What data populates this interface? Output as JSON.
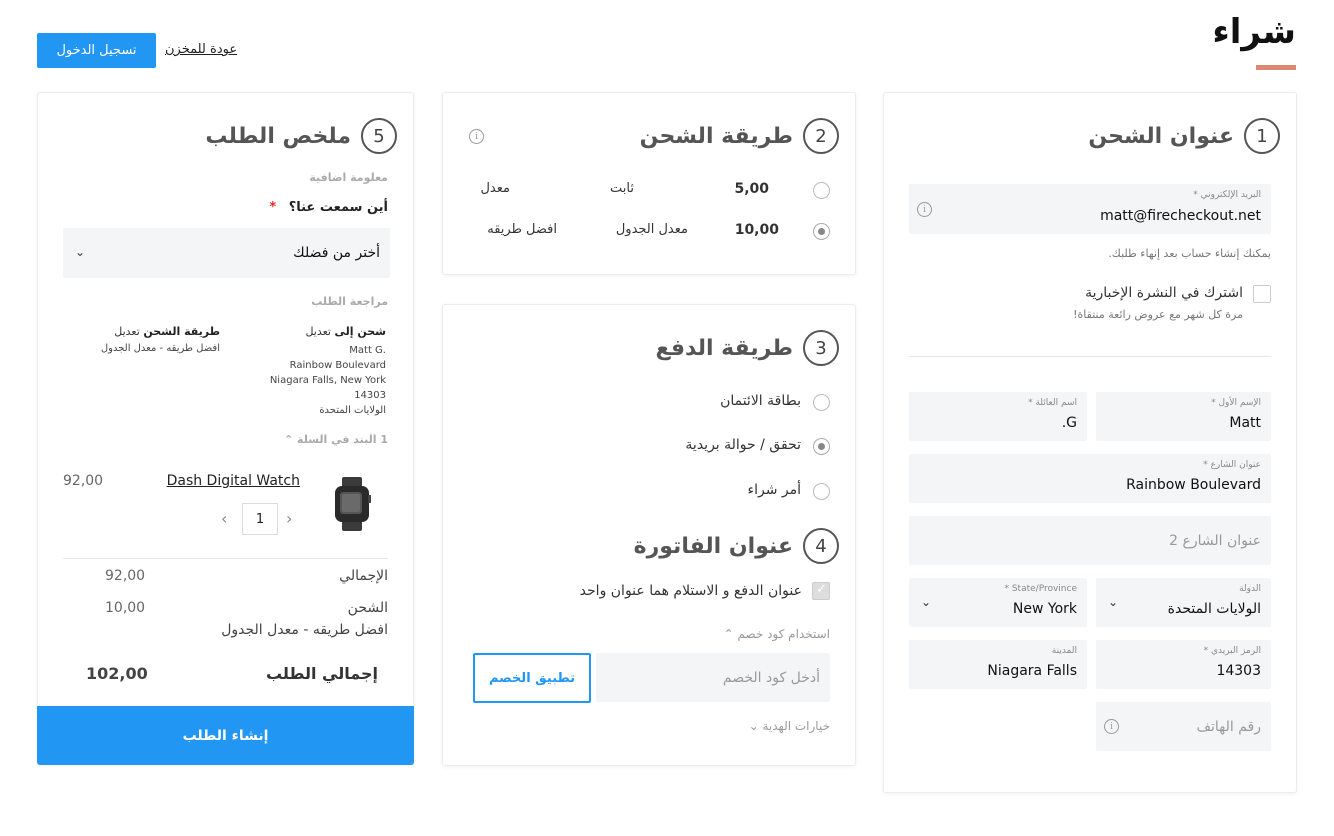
{
  "header": {
    "title": "شراء",
    "login_label": "تسجيل الدخول",
    "back_label": "عودة للمخزن"
  },
  "shipping_address": {
    "step": "1",
    "title": "عنوان الشحن",
    "email": {
      "label": "البريد الإلكتروني *",
      "value": "matt@firecheckout.net"
    },
    "email_hint": "يمكنك إنشاء حساب بعد إنهاء طلبك.",
    "newsletter": {
      "label": "اشترك في النشرة الإخبارية",
      "sub": "مرة كل شهر مع عروض رائعة منتقاة!"
    },
    "first_name": {
      "label": "الإسم الأول *",
      "value": "Matt"
    },
    "last_name": {
      "label": "اسم العائلة *",
      "value": "G."
    },
    "street1": {
      "label": "عنوان الشارع *",
      "value": "Rainbow Boulevard"
    },
    "street2": {
      "placeholder": "عنوان الشارع 2"
    },
    "country": {
      "label": "الدولة",
      "value": "الولايات المتحدة"
    },
    "state": {
      "label": "State/Province *",
      "value": "New York"
    },
    "zip": {
      "label": "الرمز البريدي *",
      "value": "14303"
    },
    "city": {
      "label": "المدينة",
      "value": "Niagara Falls"
    },
    "phone": {
      "placeholder": "رقم الهاتف"
    }
  },
  "shipping_method": {
    "step": "2",
    "title": "طريقة الشحن",
    "options": [
      {
        "price": "5,00",
        "name": "ثابت",
        "carrier": "معدل",
        "selected": false
      },
      {
        "price": "10,00",
        "name": "معدل الجدول",
        "carrier": "افضل طريقه",
        "selected": true
      }
    ]
  },
  "payment_method": {
    "step": "3",
    "title": "طريقة الدفع",
    "options": [
      {
        "label": "بطاقة الائتمان",
        "selected": false
      },
      {
        "label": "تحقق / حوالة بريدية",
        "selected": true
      },
      {
        "label": "أمر شراء",
        "selected": false
      }
    ]
  },
  "billing_address": {
    "step": "4",
    "title": "عنوان الفاتورة",
    "same_label": "عنوان الدفع و الاستلام هما عنوان واحد",
    "discount_toggle": "استخدام كود خصم",
    "discount_placeholder": "أدخل كود الخصم",
    "apply_label": "تطبيق الخصم",
    "gift_toggle": "خيارات الهدية"
  },
  "summary": {
    "step": "5",
    "title": "ملخص الطلب",
    "extra_info": "معلومة اضافية",
    "heard_label": "أين سمعت عنا؟",
    "required_mark": "*",
    "heard_placeholder": "أختر من فضلك",
    "review_label": "مراجعة الطلب",
    "ship_to": {
      "heading": "شحن إلى",
      "edit": "تعديل",
      "lines": [
        "Matt G.",
        "Rainbow Boulevard",
        "Niagara Falls, New York",
        "14303",
        "الولايات المتحدة"
      ]
    },
    "ship_method": {
      "heading": "طريقة الشحن",
      "edit": "تعديل",
      "value": "افضل طريقه - معدل الجدول"
    },
    "cart_toggle": "1 البند في السلة",
    "item": {
      "name": "Dash Digital Watch",
      "price": "92,00",
      "qty": "1"
    },
    "subtotal": {
      "label": "الإجمالي",
      "value": "92,00"
    },
    "shipping": {
      "label": "الشحن",
      "value": "10,00",
      "method": "افضل طريقه - معدل الجدول"
    },
    "grand_total": {
      "label": "إجمالي الطلب",
      "value": "102,00"
    },
    "place_order": "إنشاء الطلب"
  }
}
